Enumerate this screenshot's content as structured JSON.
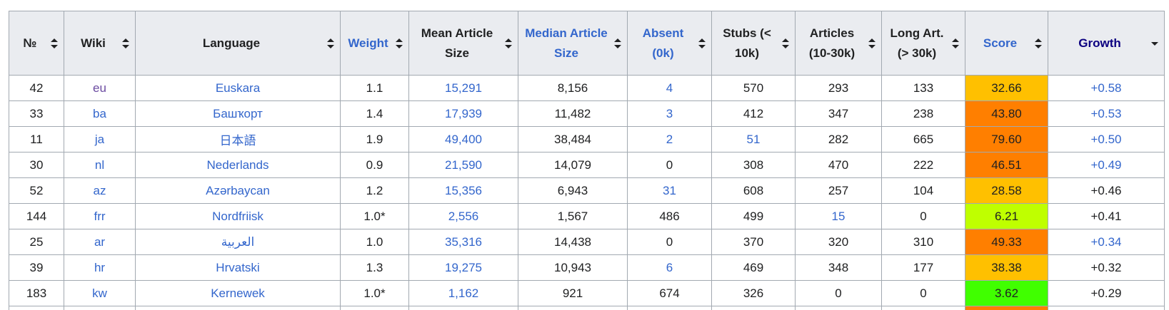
{
  "columns": [
    {
      "label": "№",
      "style": "plain",
      "sort": "both"
    },
    {
      "label": "Wiki",
      "style": "plain",
      "sort": "both"
    },
    {
      "label": "Language",
      "style": "plain",
      "sort": "both"
    },
    {
      "label": "Weight",
      "style": "link",
      "sort": "both"
    },
    {
      "label": "Mean Article Size",
      "style": "plain",
      "sort": "both"
    },
    {
      "label": "Median Article Size",
      "style": "link",
      "sort": "both"
    },
    {
      "label": "Absent (0k)",
      "style": "link",
      "sort": "both"
    },
    {
      "label": "Stubs (< 10k)",
      "style": "plain",
      "sort": "both"
    },
    {
      "label": "Articles (10-30k)",
      "style": "plain",
      "sort": "both"
    },
    {
      "label": "Long Art. (> 30k)",
      "style": "plain",
      "sort": "both"
    },
    {
      "label": "Score",
      "style": "link",
      "sort": "both"
    },
    {
      "label": "Growth",
      "style": "visited",
      "sort": "desc"
    }
  ],
  "rows": [
    {
      "no": "42",
      "wiki": "eu",
      "language": "Euskara",
      "weight": "1.1",
      "mean": "15,291",
      "median": "8,156",
      "absent": "4",
      "stubs": "570",
      "articles": "293",
      "long": "133",
      "score": "32.66",
      "growth": "+0.58",
      "score_color": "#ffc000",
      "link": {
        "wiki": "visited",
        "mean": true,
        "absent": true,
        "stubs": false,
        "articles": false,
        "growth": true
      }
    },
    {
      "no": "33",
      "wiki": "ba",
      "language": "Башҡорт",
      "weight": "1.4",
      "mean": "17,939",
      "median": "11,482",
      "absent": "3",
      "stubs": "412",
      "articles": "347",
      "long": "238",
      "score": "43.80",
      "growth": "+0.53",
      "score_color": "#ff7f00",
      "link": {
        "wiki": "link",
        "mean": true,
        "absent": true,
        "stubs": false,
        "articles": false,
        "growth": true
      }
    },
    {
      "no": "11",
      "wiki": "ja",
      "language": "日本語",
      "weight": "1.9",
      "mean": "49,400",
      "median": "38,484",
      "absent": "2",
      "stubs": "51",
      "articles": "282",
      "long": "665",
      "score": "79.60",
      "growth": "+0.50",
      "score_color": "#ff7f00",
      "link": {
        "wiki": "link",
        "mean": true,
        "absent": true,
        "stubs": true,
        "articles": false,
        "growth": true
      }
    },
    {
      "no": "30",
      "wiki": "nl",
      "language": "Nederlands",
      "weight": "0.9",
      "mean": "21,590",
      "median": "14,079",
      "absent": "0",
      "stubs": "308",
      "articles": "470",
      "long": "222",
      "score": "46.51",
      "growth": "+0.49",
      "score_color": "#ff7f00",
      "link": {
        "wiki": "link",
        "mean": true,
        "absent": false,
        "stubs": false,
        "articles": false,
        "growth": true
      }
    },
    {
      "no": "52",
      "wiki": "az",
      "language": "Azərbaycan",
      "weight": "1.2",
      "mean": "15,356",
      "median": "6,943",
      "absent": "31",
      "stubs": "608",
      "articles": "257",
      "long": "104",
      "score": "28.58",
      "growth": "+0.46",
      "score_color": "#ffc000",
      "link": {
        "wiki": "link",
        "mean": true,
        "absent": true,
        "stubs": false,
        "articles": false,
        "growth": false
      }
    },
    {
      "no": "144",
      "wiki": "frr",
      "language": "Nordfriisk",
      "weight": "1.0*",
      "mean": "2,556",
      "median": "1,567",
      "absent": "486",
      "stubs": "499",
      "articles": "15",
      "long": "0",
      "score": "6.21",
      "growth": "+0.41",
      "score_color": "#bfff00",
      "link": {
        "wiki": "link",
        "mean": true,
        "absent": false,
        "stubs": false,
        "articles": true,
        "growth": false
      }
    },
    {
      "no": "25",
      "wiki": "ar",
      "language": "العربية",
      "weight": "1.0",
      "mean": "35,316",
      "median": "14,438",
      "absent": "0",
      "stubs": "370",
      "articles": "320",
      "long": "310",
      "score": "49.33",
      "growth": "+0.34",
      "score_color": "#ff7f00",
      "link": {
        "wiki": "link",
        "mean": true,
        "absent": false,
        "stubs": false,
        "articles": false,
        "growth": true
      }
    },
    {
      "no": "39",
      "wiki": "hr",
      "language": "Hrvatski",
      "weight": "1.3",
      "mean": "19,275",
      "median": "10,943",
      "absent": "6",
      "stubs": "469",
      "articles": "348",
      "long": "177",
      "score": "38.38",
      "growth": "+0.32",
      "score_color": "#ffc000",
      "link": {
        "wiki": "link",
        "mean": true,
        "absent": true,
        "stubs": false,
        "articles": false,
        "growth": false
      }
    },
    {
      "no": "183",
      "wiki": "kw",
      "language": "Kernewek",
      "weight": "1.0*",
      "mean": "1,162",
      "median": "921",
      "absent": "674",
      "stubs": "326",
      "articles": "0",
      "long": "0",
      "score": "3.62",
      "growth": "+0.29",
      "score_color": "#40ff00",
      "link": {
        "wiki": "link",
        "mean": true,
        "absent": false,
        "stubs": false,
        "articles": false,
        "growth": false
      }
    }
  ],
  "partial_row_score_color": "#ff7f00"
}
